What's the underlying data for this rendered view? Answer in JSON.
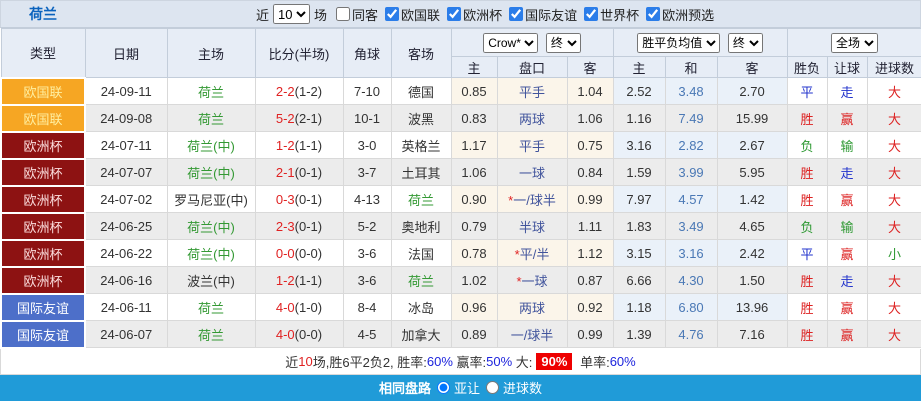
{
  "topbar": {
    "title": "荷兰",
    "recent_prefix": "近",
    "match_count": "10",
    "recent_suffix": "场",
    "same_venue_label": "同客",
    "same_venue_checked": false,
    "league_filters": [
      {
        "label": "欧国联",
        "checked": true
      },
      {
        "label": "欧洲杯",
        "checked": true
      },
      {
        "label": "国际友谊",
        "checked": true
      },
      {
        "label": "世界杯",
        "checked": true
      },
      {
        "label": "欧洲预选",
        "checked": true
      }
    ]
  },
  "controls": {
    "bookmaker": "Crow*",
    "crown_period": "终",
    "europe_type": "胜平负均值",
    "europe_period": "终",
    "scope": "全场"
  },
  "table": {
    "columns": {
      "type": "类型",
      "date": "日期",
      "home": "主场",
      "score": "比分(半场)",
      "corner": "角球",
      "away": "客场"
    },
    "subcolumns": {
      "crown_home": "主",
      "handicap": "盘口",
      "crown_away": "客",
      "euro_win": "主",
      "euro_draw": "和",
      "euro_lose": "客",
      "result_wdl": "胜负",
      "result_handicap": "让球",
      "result_goals": "进球数"
    },
    "rows": [
      {
        "league": "欧国联",
        "date": "24-09-11",
        "home": "荷兰",
        "home_green": true,
        "score": "2-2",
        "half": "(1-2)",
        "corner": "7-10",
        "away": "德国",
        "away_green": false,
        "crown_home": "0.85",
        "handicap": "平手",
        "handicap_star": false,
        "crown_away": "1.04",
        "odds_win": "2.52",
        "odds_draw": "3.48",
        "odds_lose": "2.70",
        "result_wdl": "平",
        "result_handicap": "走",
        "result_goals": "大"
      },
      {
        "league": "欧国联",
        "date": "24-09-08",
        "home": "荷兰",
        "home_green": true,
        "score": "5-2",
        "half": "(2-1)",
        "corner": "10-1",
        "away": "波黑",
        "away_green": false,
        "crown_home": "0.83",
        "handicap": "两球",
        "handicap_star": false,
        "crown_away": "1.06",
        "odds_win": "1.16",
        "odds_draw": "7.49",
        "odds_lose": "15.99",
        "result_wdl": "胜",
        "result_handicap": "赢",
        "result_goals": "大"
      },
      {
        "league": "欧洲杯",
        "date": "24-07-11",
        "home": "荷兰(中)",
        "home_green": true,
        "score": "1-2",
        "half": "(1-1)",
        "corner": "3-0",
        "away": "英格兰",
        "away_green": false,
        "crown_home": "1.17",
        "handicap": "平手",
        "handicap_star": false,
        "crown_away": "0.75",
        "odds_win": "3.16",
        "odds_draw": "2.82",
        "odds_lose": "2.67",
        "result_wdl": "负",
        "result_handicap": "输",
        "result_goals": "大"
      },
      {
        "league": "欧洲杯",
        "date": "24-07-07",
        "home": "荷兰(中)",
        "home_green": true,
        "score": "2-1",
        "half": "(0-1)",
        "corner": "3-7",
        "away": "土耳其",
        "away_green": false,
        "crown_home": "1.06",
        "handicap": "一球",
        "handicap_star": false,
        "crown_away": "0.84",
        "odds_win": "1.59",
        "odds_draw": "3.99",
        "odds_lose": "5.95",
        "result_wdl": "胜",
        "result_handicap": "走",
        "result_goals": "大"
      },
      {
        "league": "欧洲杯",
        "date": "24-07-02",
        "home": "罗马尼亚(中)",
        "home_green": false,
        "score": "0-3",
        "half": "(0-1)",
        "corner": "4-13",
        "away": "荷兰",
        "away_green": true,
        "crown_home": "0.90",
        "handicap": "一/球半",
        "handicap_star": true,
        "crown_away": "0.99",
        "odds_win": "7.97",
        "odds_draw": "4.57",
        "odds_lose": "1.42",
        "result_wdl": "胜",
        "result_handicap": "赢",
        "result_goals": "大"
      },
      {
        "league": "欧洲杯",
        "date": "24-06-25",
        "home": "荷兰(中)",
        "home_green": true,
        "score": "2-3",
        "half": "(0-1)",
        "corner": "5-2",
        "away": "奥地利",
        "away_green": false,
        "crown_home": "0.79",
        "handicap": "半球",
        "handicap_star": false,
        "crown_away": "1.11",
        "odds_win": "1.83",
        "odds_draw": "3.49",
        "odds_lose": "4.65",
        "result_wdl": "负",
        "result_handicap": "输",
        "result_goals": "大"
      },
      {
        "league": "欧洲杯",
        "date": "24-06-22",
        "home": "荷兰(中)",
        "home_green": true,
        "score": "0-0",
        "half": "(0-0)",
        "corner": "3-6",
        "away": "法国",
        "away_green": false,
        "crown_home": "0.78",
        "handicap": "平/半",
        "handicap_star": true,
        "crown_away": "1.12",
        "odds_win": "3.15",
        "odds_draw": "3.16",
        "odds_lose": "2.42",
        "result_wdl": "平",
        "result_handicap": "赢",
        "result_goals": "小"
      },
      {
        "league": "欧洲杯",
        "date": "24-06-16",
        "home": "波兰(中)",
        "home_green": false,
        "score": "1-2",
        "half": "(1-1)",
        "corner": "3-6",
        "away": "荷兰",
        "away_green": true,
        "crown_home": "1.02",
        "handicap": "一球",
        "handicap_star": true,
        "crown_away": "0.87",
        "odds_win": "6.66",
        "odds_draw": "4.30",
        "odds_lose": "1.50",
        "result_wdl": "胜",
        "result_handicap": "走",
        "result_goals": "大"
      },
      {
        "league": "国际友谊",
        "date": "24-06-11",
        "home": "荷兰",
        "home_green": true,
        "score": "4-0",
        "half": "(1-0)",
        "corner": "8-4",
        "away": "冰岛",
        "away_green": false,
        "crown_home": "0.96",
        "handicap": "两球",
        "handicap_star": false,
        "crown_away": "0.92",
        "odds_win": "1.18",
        "odds_draw": "6.80",
        "odds_lose": "13.96",
        "result_wdl": "胜",
        "result_handicap": "赢",
        "result_goals": "大"
      },
      {
        "league": "国际友谊",
        "date": "24-06-07",
        "home": "荷兰",
        "home_green": true,
        "score": "4-0",
        "half": "(0-0)",
        "corner": "4-5",
        "away": "加拿大",
        "away_green": false,
        "crown_home": "0.89",
        "handicap": "一/球半",
        "handicap_star": false,
        "crown_away": "0.99",
        "odds_win": "1.39",
        "odds_draw": "4.76",
        "odds_lose": "7.16",
        "result_wdl": "胜",
        "result_handicap": "赢",
        "result_goals": "大"
      }
    ]
  },
  "league_colors": {
    "欧国联": "orange",
    "欧洲杯": "maroon",
    "国际友谊": "blue"
  },
  "result_colors": {
    "胜": "red",
    "平": "blue",
    "负": "green",
    "赢": "red",
    "走": "blue",
    "输": "green",
    "大": "red",
    "小": "green"
  },
  "colors": {
    "league_orange": "#f6a623",
    "league_maroon": "#8d1212",
    "league_blue": "#4d6fc9",
    "team_highlight_green": "#339933",
    "score_red": "#e02222",
    "handicap_navy": "#41549c",
    "draw_odds_blue": "#4a78b5",
    "result_red": "#dd2222",
    "result_blue": "#2233cc",
    "result_green": "#2e9933",
    "rate_badge_red": "#ee0000",
    "footer_bar_blue": "#209bd8",
    "title_blue": "#0a62bd"
  },
  "summary": {
    "segments": [
      {
        "text": "近",
        "style": "black"
      },
      {
        "text": "10",
        "style": "red"
      },
      {
        "text": "场,胜6平2负2, 胜率:",
        "style": "black"
      },
      {
        "text": "60%",
        "style": "blue"
      },
      {
        "text": " 赢率:",
        "style": "black"
      },
      {
        "text": "50%",
        "style": "blue"
      },
      {
        "text": " 大:",
        "style": "black"
      },
      {
        "text": "90%",
        "style": "badge"
      },
      {
        "text": " 单率:",
        "style": "black"
      },
      {
        "text": "60%",
        "style": "blue"
      }
    ]
  },
  "footer": {
    "title": "相同盘路",
    "options": [
      {
        "label": "亚让",
        "checked": true
      },
      {
        "label": "进球数",
        "checked": false
      }
    ]
  }
}
